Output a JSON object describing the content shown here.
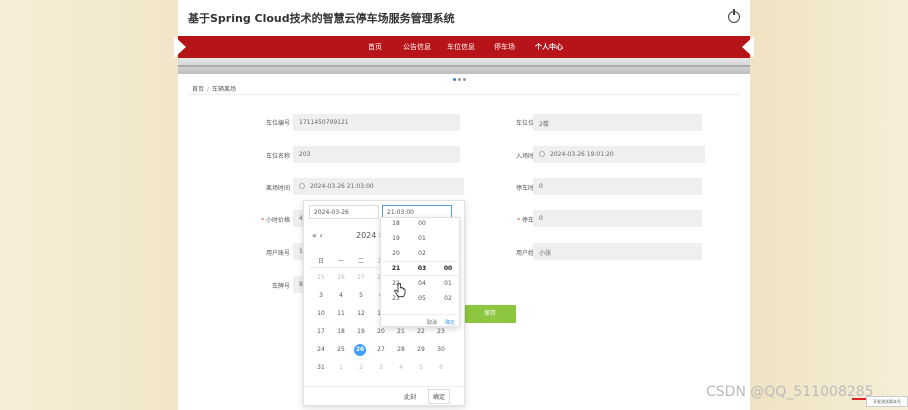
{
  "header": {
    "title": "基于Spring Cloud技术的智慧云停车场服务管理系统"
  },
  "nav": {
    "items": [
      "首页",
      "公告信息",
      "车位信息",
      "停车场",
      "个人中心"
    ],
    "active": "个人中心"
  },
  "breadcrumb": [
    "首页",
    "车辆离场"
  ],
  "form": {
    "parking_no_label": "车位编号",
    "parking_no": "1711450799121",
    "parking_pos_label": "车位位置",
    "parking_pos": "2楼",
    "parking_name_label": "车位名称",
    "parking_name": "203",
    "entry_time_label": "入场时间",
    "entry_time": "2024-03-26 19:01:20",
    "leave_time_label": "离场时间",
    "leave_time": "2024-03-26 21:03:00",
    "duration_label": "停车时长",
    "duration": "0",
    "hourly_price_label": "小时价格",
    "hourly_price": "4",
    "fee_label": "停车费",
    "fee": "0",
    "user_account_label": "用户账号",
    "user_account": "1",
    "user_name_label": "用户姓名",
    "user_name": "小张",
    "plate_label": "车牌号",
    "plate": "8",
    "save": "保存"
  },
  "datepicker": {
    "date_input": "2024-03-26",
    "time_input": "21:03:00",
    "nav_prev": "«  ‹",
    "year": "2024 年",
    "weekdays": [
      "日",
      "一",
      "二",
      "三"
    ],
    "days": [
      [
        "25",
        "26",
        "27",
        "28"
      ],
      [
        "3",
        "4",
        "5",
        "6"
      ],
      [
        "10",
        "11",
        "12",
        "13"
      ],
      [
        "17",
        "18",
        "19",
        "20",
        "21",
        "22",
        "23"
      ],
      [
        "24",
        "25",
        "26",
        "27",
        "28",
        "29",
        "30"
      ],
      [
        "31",
        "1",
        "2",
        "3",
        "4",
        "5",
        "6"
      ]
    ],
    "today": "26",
    "now": "此刻",
    "confirm": "确定"
  },
  "timepicker": {
    "hours": [
      "18",
      "19",
      "20",
      "21",
      "22",
      "23"
    ],
    "minutes": [
      "00",
      "01",
      "02",
      "03",
      "04",
      "05"
    ],
    "seconds": [
      "",
      "",
      "",
      "00",
      "01",
      "02"
    ],
    "cancel": "取消",
    "ok": "确定"
  },
  "watermark": "CSDN @QQ_511008285",
  "corner_badge": "开发测试版本号"
}
